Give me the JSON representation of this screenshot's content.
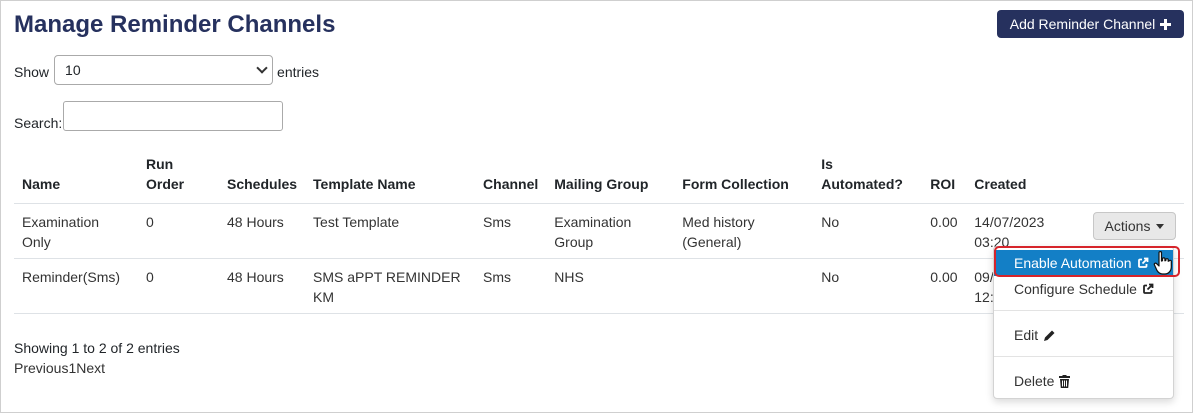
{
  "page": {
    "title": "Manage Reminder Channels",
    "add_button_label": "Add Reminder Channel"
  },
  "length": {
    "show_label": "Show",
    "selected": "10",
    "entries_label": "entries"
  },
  "search": {
    "label": "Search:",
    "value": ""
  },
  "table": {
    "headers": {
      "name": "Name",
      "run_order_1": "Run",
      "run_order_2": "Order",
      "schedules": "Schedules",
      "template_name": "Template Name",
      "channel": "Channel",
      "mailing_group": "Mailing Group",
      "form_collection": "Form Collection",
      "is_automated_1": "Is",
      "is_automated_2": "Automated?",
      "roi": "ROI",
      "created": "Created"
    },
    "rows": [
      {
        "name_1": "Examination",
        "name_2": "Only",
        "run_order": "0",
        "schedules": "48 Hours",
        "template_name_1": "Test Template",
        "template_name_2": "",
        "channel": "Sms",
        "mailing_group_1": "Examination",
        "mailing_group_2": "Group",
        "form_collection_1": "Med history",
        "form_collection_2": "(General)",
        "is_automated": "No",
        "roi": "0.00",
        "created_1": "14/07/2023",
        "created_2": "03:20"
      },
      {
        "name_1": "Reminder(Sms)",
        "name_2": "",
        "run_order": "0",
        "schedules": "48 Hours",
        "template_name_1": "SMS aPPT REMINDER",
        "template_name_2": "KM",
        "channel": "Sms",
        "mailing_group_1": "NHS",
        "mailing_group_2": "",
        "form_collection_1": "",
        "form_collection_2": "",
        "is_automated": "No",
        "roi": "0.00",
        "created_1": "09/",
        "created_2": "12:"
      }
    ]
  },
  "actions": {
    "button_label": "Actions",
    "menu": [
      {
        "label": "Enable Automation",
        "icon": "external-link-icon",
        "active": true
      },
      {
        "label": "Configure Schedule",
        "icon": "external-link-icon",
        "active": false
      },
      {
        "label": "Edit",
        "icon": "pencil-icon",
        "active": false
      },
      {
        "label": "Delete",
        "icon": "trash-icon",
        "active": false
      }
    ]
  },
  "footer": {
    "info": "Showing 1 to 2 of 2 entries",
    "previous": "Previous",
    "page": "1",
    "next": "Next"
  },
  "colors": {
    "primary": "#26315e",
    "menu_active": "#137fc6",
    "highlight": "#d6242b"
  }
}
